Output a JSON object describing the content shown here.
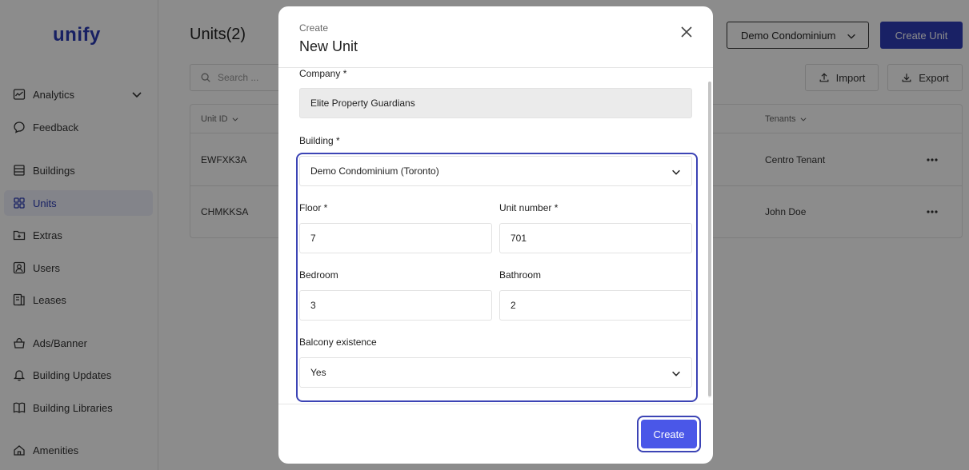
{
  "app": {
    "logo": "unify",
    "accent": "#2f3db8"
  },
  "sidebar": {
    "items": [
      {
        "label": "Analytics",
        "icon": "analytics-icon",
        "expandable": true
      },
      {
        "label": "Feedback",
        "icon": "feedback-icon"
      },
      {
        "label": "Buildings",
        "icon": "buildings-icon"
      },
      {
        "label": "Units",
        "icon": "units-icon",
        "active": true
      },
      {
        "label": "Extras",
        "icon": "extras-icon"
      },
      {
        "label": "Users",
        "icon": "users-icon"
      },
      {
        "label": "Leases",
        "icon": "leases-icon"
      },
      {
        "label": "Ads/Banner",
        "icon": "ads-banner-icon"
      },
      {
        "label": "Building Updates",
        "icon": "bell-icon"
      },
      {
        "label": "Building Libraries",
        "icon": "book-icon"
      },
      {
        "label": "Amenities",
        "icon": "amenities-icon"
      }
    ]
  },
  "header": {
    "title": "Units(2)",
    "building_select": "Demo Condominium",
    "create_unit_label": "Create Unit"
  },
  "toolbar": {
    "search_placeholder": "Search ...",
    "import_label": "Import",
    "export_label": "Export"
  },
  "table": {
    "columns": [
      "Unit ID",
      "Tenants"
    ],
    "rows": [
      {
        "unit_id": "EWFXK3A",
        "tenants": "Centro Tenant"
      },
      {
        "unit_id": "CHMKKSA",
        "tenants": "John Doe"
      }
    ]
  },
  "modal": {
    "subtitle": "Create",
    "title": "New Unit",
    "fields": {
      "company": {
        "label": "Company *",
        "value": "Elite Property Guardians"
      },
      "building": {
        "label": "Building *",
        "value": "Demo Condominium (Toronto)"
      },
      "floor": {
        "label": "Floor *",
        "value": "7"
      },
      "unit_number": {
        "label": "Unit number *",
        "value": "701"
      },
      "bedroom": {
        "label": "Bedroom",
        "value": "3"
      },
      "bathroom": {
        "label": "Bathroom",
        "value": "2"
      },
      "balcony": {
        "label": "Balcony existence",
        "value": "Yes"
      }
    },
    "create_label": "Create"
  }
}
